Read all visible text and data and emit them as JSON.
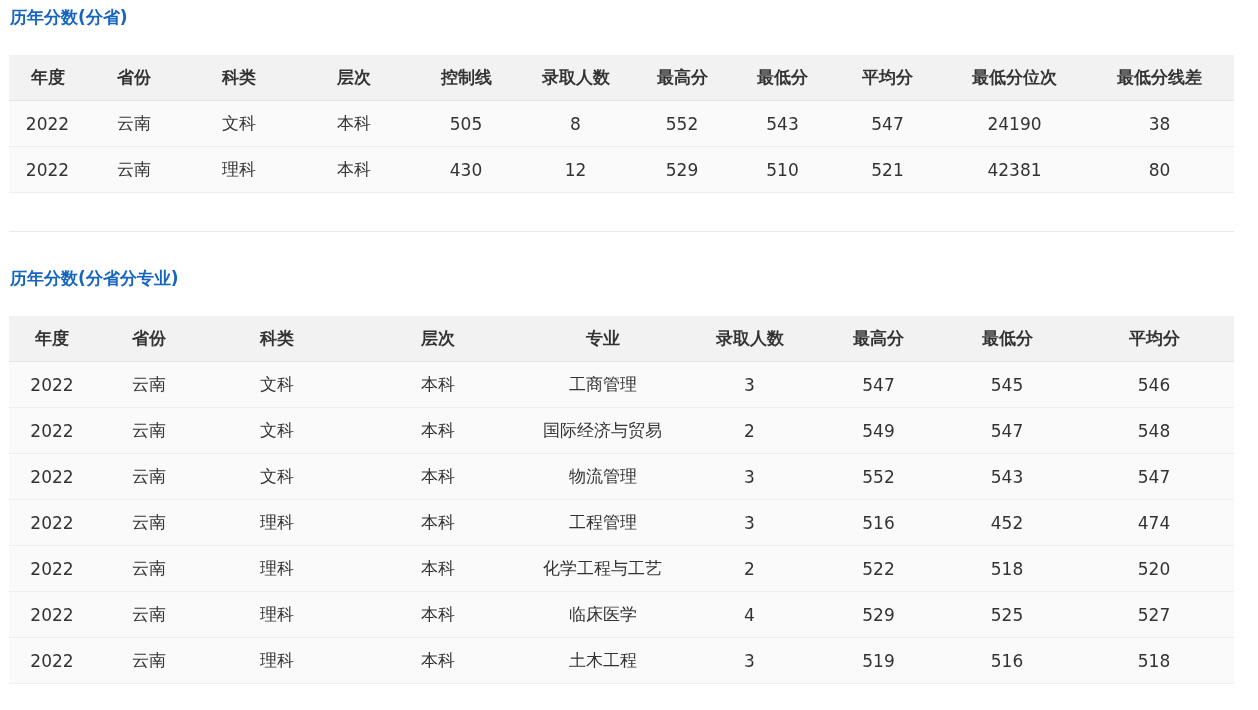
{
  "sections": [
    {
      "title": "历年分数(分省)",
      "table": {
        "columns": [
          "年度",
          "省份",
          "科类",
          "层次",
          "控制线",
          "录取人数",
          "最高分",
          "最低分",
          "平均分",
          "最低分位次",
          "最低分线差"
        ],
        "rows": [
          [
            "2022",
            "云南",
            "文科",
            "本科",
            "505",
            "8",
            "552",
            "543",
            "547",
            "24190",
            "38"
          ],
          [
            "2022",
            "云南",
            "理科",
            "本科",
            "430",
            "12",
            "529",
            "510",
            "521",
            "42381",
            "80"
          ]
        ]
      }
    },
    {
      "title": "历年分数(分省分专业)",
      "table": {
        "columns": [
          "年度",
          "省份",
          "科类",
          "层次",
          "专业",
          "录取人数",
          "最高分",
          "最低分",
          "平均分"
        ],
        "rows": [
          [
            "2022",
            "云南",
            "文科",
            "本科",
            "工商管理",
            "3",
            "547",
            "545",
            "546"
          ],
          [
            "2022",
            "云南",
            "文科",
            "本科",
            "国际经济与贸易",
            "2",
            "549",
            "547",
            "548"
          ],
          [
            "2022",
            "云南",
            "文科",
            "本科",
            "物流管理",
            "3",
            "552",
            "543",
            "547"
          ],
          [
            "2022",
            "云南",
            "理科",
            "本科",
            "工程管理",
            "3",
            "516",
            "452",
            "474"
          ],
          [
            "2022",
            "云南",
            "理科",
            "本科",
            "化学工程与工艺",
            "2",
            "522",
            "518",
            "520"
          ],
          [
            "2022",
            "云南",
            "理科",
            "本科",
            "临床医学",
            "4",
            "529",
            "525",
            "527"
          ],
          [
            "2022",
            "云南",
            "理科",
            "本科",
            "土木工程",
            "3",
            "519",
            "516",
            "518"
          ]
        ]
      }
    }
  ]
}
